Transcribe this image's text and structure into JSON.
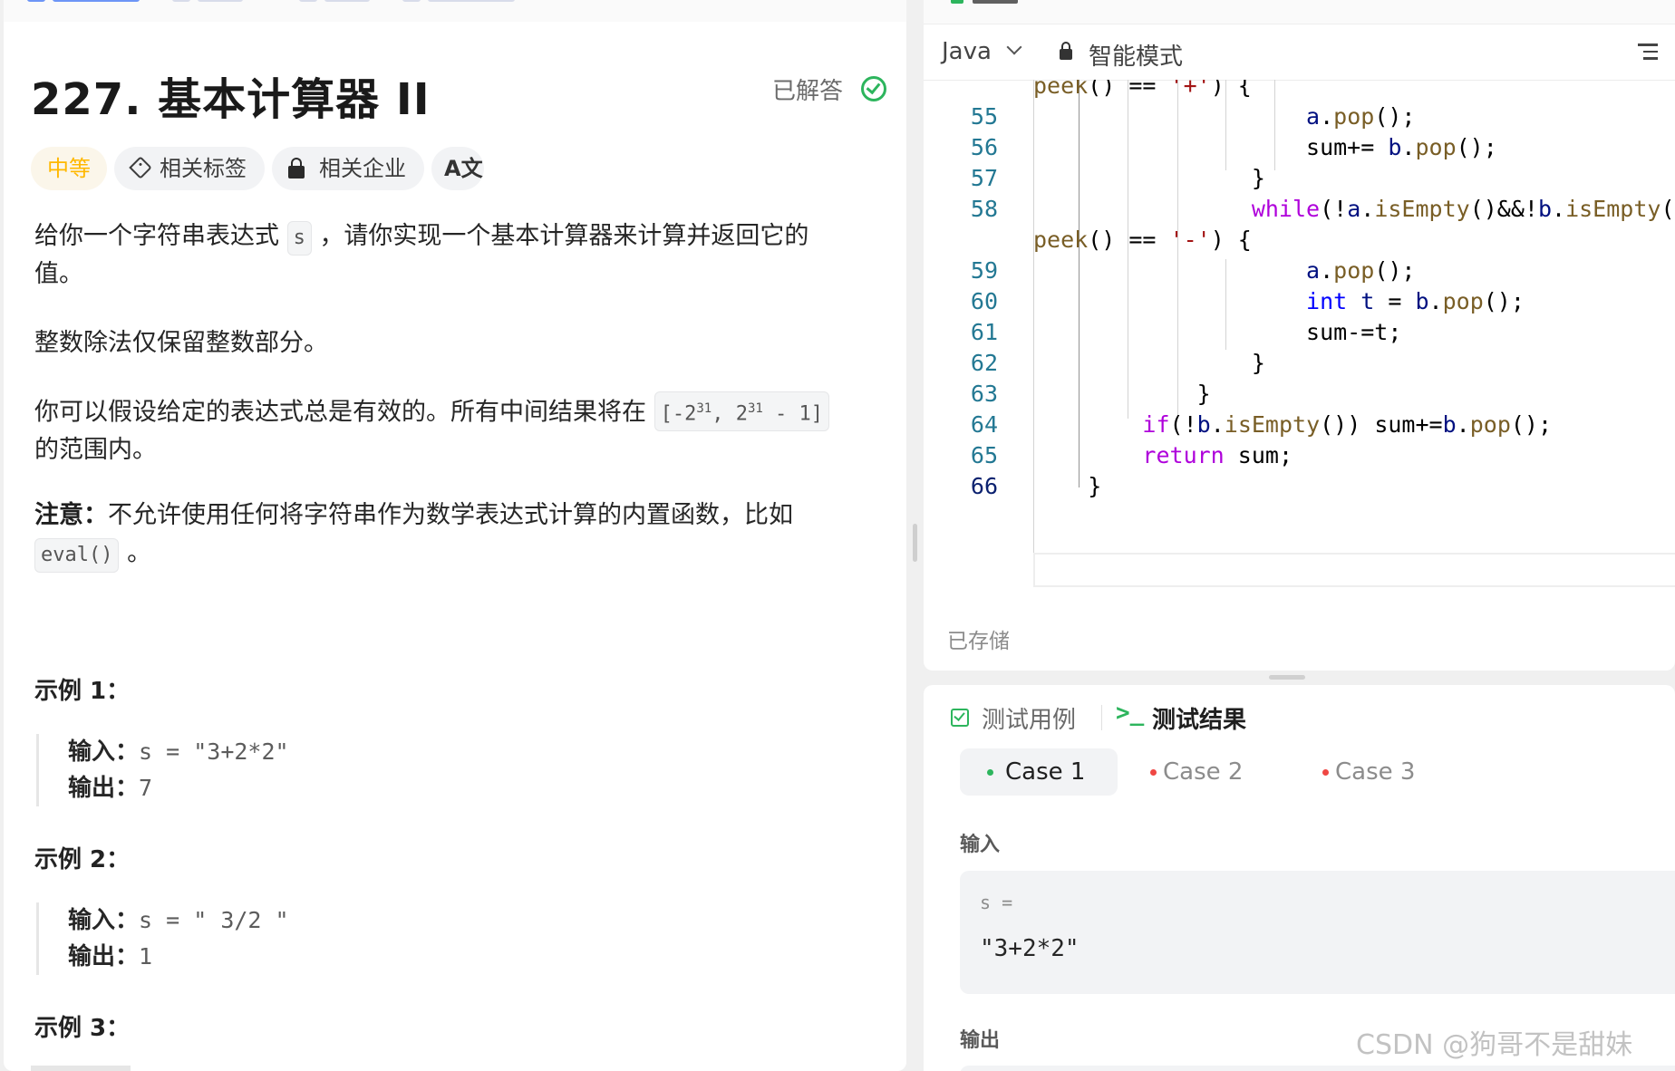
{
  "problem": {
    "title": "227. 基本计算器 II",
    "status": "已解答",
    "difficulty": "中等",
    "tags_label": "相关标签",
    "companies_label": "相关企业",
    "translate_label": "A文",
    "desc_p1_a": "给你一个字符串表达式",
    "desc_p1_code": "s",
    "desc_p1_b": "，请你实现一个基本计算器来计算并返回它的",
    "desc_p1_c": "值。",
    "desc_p2": "整数除法仅保留整数部分。",
    "desc_p3_a": "你可以假设给定的表达式总是有效的。所有中间结果将在",
    "desc_p3_code_a": "[-2",
    "desc_p3_code_sup1": "31",
    "desc_p3_code_b": ", 2",
    "desc_p3_code_sup2": "31",
    "desc_p3_code_c": " - 1]",
    "desc_p3_b": "的范围内。",
    "note_label": "注意：",
    "note_text": "不允许使用任何将字符串作为数学表达式计算的内置函数，比如",
    "note_code": "eval()",
    "note_end": "。",
    "examples": [
      {
        "heading": "示例 1：",
        "input_label": "输入：",
        "input": "s = \"3+2*2\"",
        "output_label": "输出：",
        "output": "7"
      },
      {
        "heading": "示例 2：",
        "input_label": "输入：",
        "input": "s = \" 3/2 \"",
        "output_label": "输出：",
        "output": "1"
      },
      {
        "heading": "示例 3：",
        "input_label": "",
        "input": "",
        "output_label": "",
        "output": ""
      }
    ]
  },
  "editor": {
    "language": "Java",
    "mode": "智能模式",
    "saved_status": "已存储",
    "line_numbers": [
      "55",
      "56",
      "57",
      "58",
      "59",
      "60",
      "61",
      "62",
      "63",
      "64",
      "65",
      "66"
    ]
  },
  "tests": {
    "tab_testcase": "测试用例",
    "tab_result_icon": ">_",
    "tab_result": "测试结果",
    "cases": [
      "Case 1",
      "Case 2",
      "Case 3"
    ],
    "input_label": "输入",
    "input_var": "s =",
    "input_value": "\"3+2*2\"",
    "output_label": "输出"
  },
  "watermark": "CSDN @狗哥不是甜妹",
  "colors": {
    "accent_green": "#2db55d",
    "difficulty_medium": "#ffb800",
    "error_red": "#ef4743"
  }
}
